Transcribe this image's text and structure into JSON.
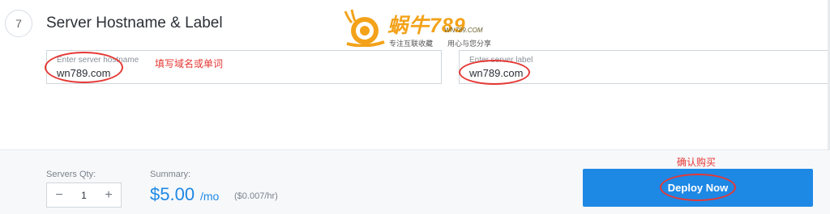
{
  "section": {
    "step_number": "7",
    "title": "Server Hostname & Label"
  },
  "hostname_field": {
    "placeholder": "Enter server hostname",
    "value": "wn789.com"
  },
  "label_field": {
    "placeholder": "Enter server label",
    "value": "wn789.com"
  },
  "annotations": {
    "fill_hint": "填写域名或单词",
    "confirm_hint": "确认购买",
    "color": "#e53935"
  },
  "watermark": {
    "main": "蜗牛789",
    "small": "WN789.COM",
    "tagline_left": "专注互联收藏",
    "tagline_right": "用心与您分享"
  },
  "footer": {
    "qty_label": "Servers Qty:",
    "qty_value": "1",
    "minus": "−",
    "plus": "+",
    "summary_label": "Summary:",
    "price": "$5.00",
    "price_unit": "/mo",
    "price_hourly": "($0.007/hr)",
    "deploy_label": "Deploy Now"
  },
  "colors": {
    "accent": "#1e88e5",
    "footer_bg": "#f7f8fa"
  }
}
